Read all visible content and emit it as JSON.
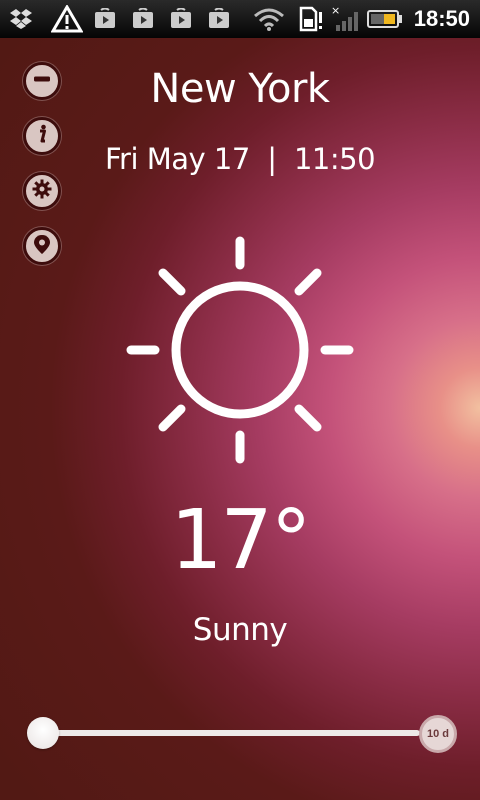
{
  "status_bar": {
    "time": "18:50",
    "icons": [
      "dropbox-icon",
      "alert-icon",
      "play-store-icon",
      "play-store-icon",
      "play-store-icon",
      "play-store-icon",
      "wifi-icon",
      "sim-alert-icon",
      "signal-icon",
      "battery-icon"
    ]
  },
  "sidebar": {
    "buttons": [
      {
        "name": "remove",
        "icon": "minus-icon"
      },
      {
        "name": "info",
        "icon": "info-icon"
      },
      {
        "name": "settings",
        "icon": "gear-icon"
      },
      {
        "name": "location",
        "icon": "location-pin-icon"
      }
    ]
  },
  "weather": {
    "city": "New York",
    "datetime": "Fri May 17  |  11:50",
    "icon": "sun-icon",
    "temperature": "17°",
    "condition": "Sunny"
  },
  "timeline": {
    "end_label": "10 d",
    "position": 0
  },
  "colors": {
    "background": "#5a1a18",
    "accent_glow": "#f2c0a0",
    "text": "#ffffff"
  }
}
